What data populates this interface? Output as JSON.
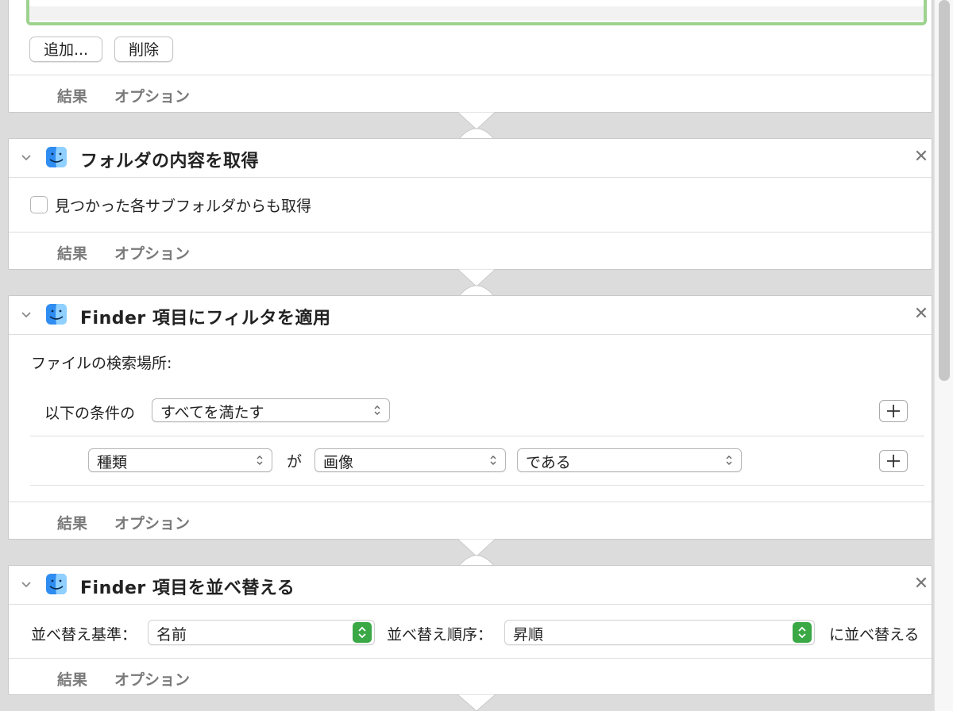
{
  "top_card": {
    "add_button": "追加...",
    "delete_button": "削除",
    "footer": {
      "results": "結果",
      "options": "オプション"
    }
  },
  "card_folder": {
    "title": "フォルダの内容を取得",
    "checkbox_label": "見つかった各サブフォルダからも取得",
    "footer": {
      "results": "結果",
      "options": "オプション"
    }
  },
  "card_filter": {
    "title": "Finder 項目にフィルタを適用",
    "search_location_label": "ファイルの検索場所:",
    "condition_prefix": "以下の条件の",
    "condition_select": "すべてを満たす",
    "rule": {
      "field": "種類",
      "connector": "が",
      "value": "画像",
      "operator": "である"
    },
    "footer": {
      "results": "結果",
      "options": "オプション"
    }
  },
  "card_sort": {
    "title": "Finder 項目を並べ替える",
    "sort_by_label": "並べ替え基準：",
    "sort_by_value": "名前",
    "order_label": "並べ替え順序：",
    "order_value": "昇順",
    "suffix": "に並べ替える",
    "footer": {
      "results": "結果",
      "options": "オプション"
    }
  },
  "colors": {
    "accent_green": "#39a845",
    "highlight_border": "#9ed28f"
  }
}
